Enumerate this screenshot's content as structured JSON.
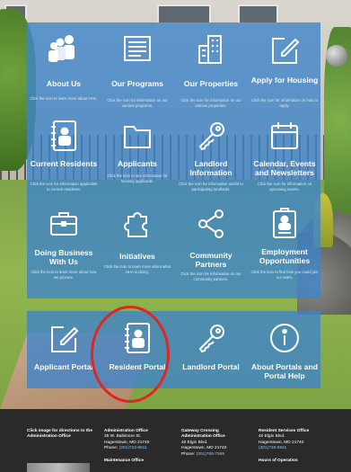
{
  "tiles": [
    {
      "id": "about-us",
      "label": "About Us",
      "desc": "Click the icon to learn more about HHA.",
      "icon": "people-icon"
    },
    {
      "id": "our-programs",
      "label": "Our Programs",
      "desc": "Click the icon for information on our various programs.",
      "icon": "document-icon"
    },
    {
      "id": "our-properties",
      "label": "Our Properties",
      "desc": "Click the icon for information on our various properties.",
      "icon": "buildings-icon"
    },
    {
      "id": "apply-for-housing",
      "label": "Apply for Housing",
      "desc": "Click the icon for information on how to apply.",
      "icon": "pencil-form-icon"
    },
    {
      "id": "current-residents",
      "label": "Current Residents",
      "desc": "Click the icon for information applicable to current residents.",
      "icon": "address-book-icon"
    },
    {
      "id": "applicants",
      "label": "Applicants",
      "desc": "Click the icon to see information for housing applicants.",
      "icon": "folder-icon"
    },
    {
      "id": "landlord-information",
      "label": "Landlord Information",
      "desc": "Click the icon for information useful to participating landlords.",
      "icon": "key-icon"
    },
    {
      "id": "calendar-events",
      "label": "Calendar, Events and Newsletters",
      "desc": "Click the icon for information on upcoming events.",
      "icon": "calendar-icon"
    },
    {
      "id": "doing-business",
      "label": "Doing Business With Us",
      "desc": "Click the icon to learn more about how we procure.",
      "icon": "briefcase-icon"
    },
    {
      "id": "initiatives",
      "label": "Initiatives",
      "desc": "Click the icon to learn more about what HHA is doing.",
      "icon": "puzzle-icon"
    },
    {
      "id": "community-partners",
      "label": "Community Partners",
      "desc": "Click the icon for information on our community partners.",
      "icon": "share-icon"
    },
    {
      "id": "employment",
      "label": "Employment Opportunities",
      "desc": "Click the icon to find how you could join our team.",
      "icon": "id-card-icon"
    }
  ],
  "portals": [
    {
      "id": "applicant-portal",
      "label": "Applicant Portal",
      "icon": "pencil-form-icon"
    },
    {
      "id": "resident-portal",
      "label": "Resident Portal",
      "icon": "address-book-icon"
    },
    {
      "id": "landlord-portal",
      "label": "Landlord Portal",
      "icon": "key-icon"
    },
    {
      "id": "about-portals",
      "label": "About Portals and Portal Help",
      "icon": "info-icon"
    }
  ],
  "colors": {
    "panel": "#3e84c9",
    "highlight": "#e0261f",
    "footer": "#2a2a2a",
    "link": "#9cc5ef"
  },
  "footer": {
    "directions": "Click image for directions to the Administration Office",
    "admin": {
      "title": "Administration Office",
      "l1": "35 W. Baltimore St.",
      "l2": "Hagerstown, MD 21740",
      "phone_prefix": "Phone:",
      "phone": "(301)733-6911"
    },
    "maint": {
      "title": "Maintenance Office"
    },
    "gateway": {
      "title": "Gateway Crossing Administration Office",
      "l1": "40 Elgin Blvd.",
      "l2": "Hagerstown, MD 21740",
      "phone_prefix": "Phone:",
      "phone": "(301)766-7969"
    },
    "resident": {
      "title": "Resident Services Office",
      "l1": "40 Elgin Blvd.",
      "l2": "Hagerstown, MD 21740",
      "phone": "(301)733-6911"
    },
    "hours": {
      "title": "Hours of Operation"
    }
  }
}
